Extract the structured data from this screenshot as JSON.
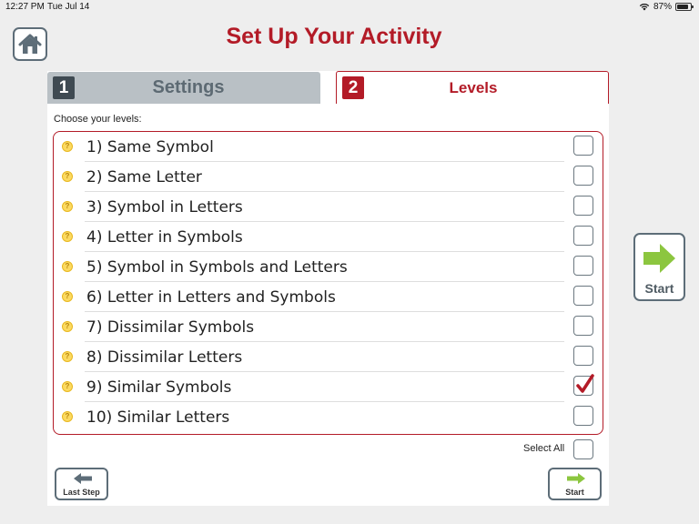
{
  "status_bar": {
    "time": "12:27 PM",
    "date": "Tue Jul 14",
    "battery_percent": "87%",
    "battery_level": 0.87,
    "wifi_icon": "wifi-icon"
  },
  "header": {
    "title": "Set Up Your Activity",
    "home_icon": "home-icon"
  },
  "tabs": [
    {
      "number": "1",
      "label": "Settings",
      "active": false
    },
    {
      "number": "2",
      "label": "Levels",
      "active": true
    }
  ],
  "levels_section": {
    "prompt": "Choose your levels:",
    "levels": [
      {
        "label": "1) Same Symbol",
        "checked": false
      },
      {
        "label": "2) Same Letter",
        "checked": false
      },
      {
        "label": "3) Symbol in Letters",
        "checked": false
      },
      {
        "label": "4) Letter in Symbols",
        "checked": false
      },
      {
        "label": "5) Symbol in Symbols and Letters",
        "checked": false
      },
      {
        "label": "6) Letter in Letters and Symbols",
        "checked": false
      },
      {
        "label": "7) Dissimilar Symbols",
        "checked": false
      },
      {
        "label": "8) Dissimilar Letters",
        "checked": false
      },
      {
        "label": "9) Similar Symbols",
        "checked": true
      },
      {
        "label": "10) Similar Letters",
        "checked": false
      }
    ],
    "select_all_label": "Select All",
    "select_all_checked": false
  },
  "footer": {
    "last_step_label": "Last Step",
    "start_label": "Start"
  },
  "side_start": {
    "label": "Start"
  },
  "colors": {
    "accent_red": "#b31b27",
    "arrow_green": "#8cc63f",
    "arrow_gray": "#5d6d78"
  }
}
